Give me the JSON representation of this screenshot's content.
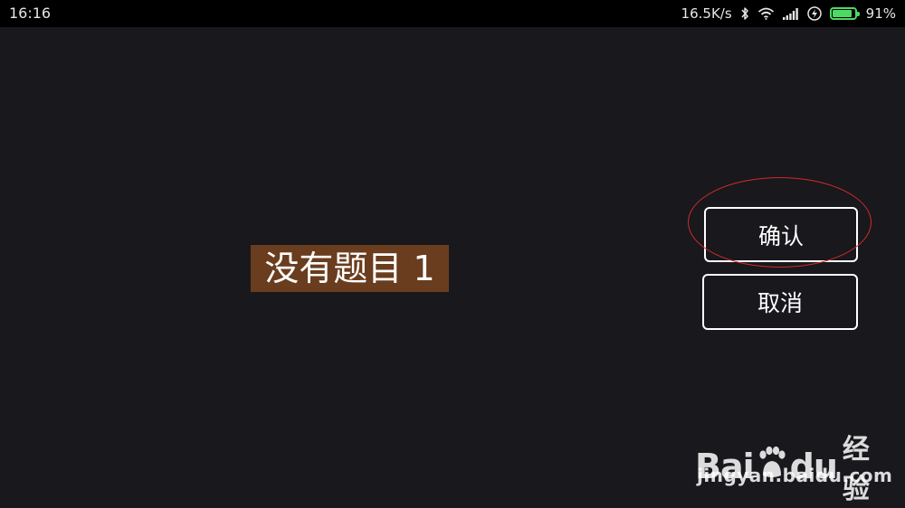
{
  "status_bar": {
    "time": "16:16",
    "network_speed": "16.5K/s",
    "icons": [
      "bluetooth-icon",
      "wifi-icon",
      "signal-icon",
      "charging-icon",
      "battery-icon"
    ],
    "battery_level": 0.91,
    "battery_percent": "91%",
    "battery_color": "#4cd964"
  },
  "main": {
    "title": "没有题目 1",
    "title_background": "#6a3d1e",
    "background": "#18181d"
  },
  "dialog": {
    "confirm_label": "确认",
    "cancel_label": "取消"
  },
  "annotation": {
    "highlight_color": "#d42a2a"
  },
  "watermark": {
    "logo_text_left": "Bai",
    "logo_text_right": "du",
    "logo_suffix": "经验",
    "url": "jingyan.baidu.com"
  }
}
